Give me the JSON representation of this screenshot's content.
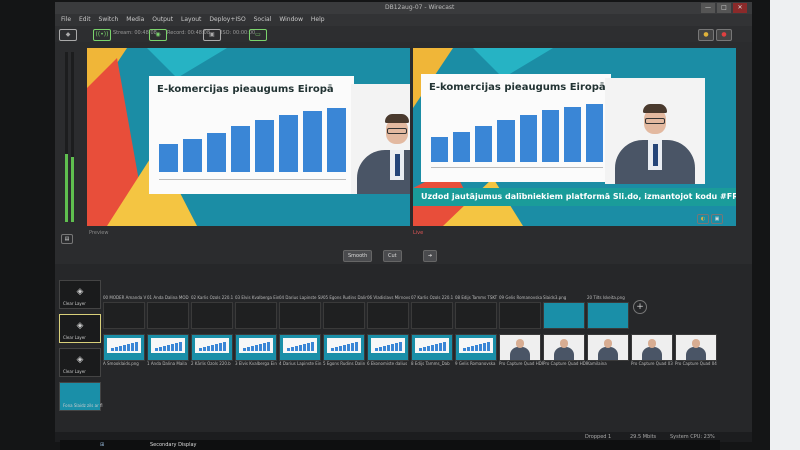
{
  "window": {
    "title": "DB12aug-07 - Wirecast",
    "min": "—",
    "max": "□",
    "close": "✕"
  },
  "menu": [
    "File",
    "Edit",
    "Switch",
    "Media",
    "Output",
    "Layout",
    "Deploy+ISO",
    "Social",
    "Window",
    "Help"
  ],
  "status": {
    "stream_icon": "broadcast-icon",
    "stream_label": "Stream: 00:48:08",
    "record_label": "Record: 00:48:08",
    "iso_label": "ISO: 00:00:00",
    "right_buttons": [
      "●",
      "●"
    ]
  },
  "preview": {
    "slide_title": "E-komercijas pieaugums Eiropā",
    "label": "Preview"
  },
  "live": {
    "slide_title": "E-komercijas pieaugums Eiropā",
    "banner": "Uzdod jautājumus dalībniekiem platformā Sli.do, izmantojot kodu #FR21",
    "label": "Live"
  },
  "transitions": {
    "smooth": "Smooth",
    "cut": "Cut",
    "go": "➔"
  },
  "layers": [
    "Clear Layer",
    "Clear Layer",
    "Clear Layer",
    "Fona Slaidz zils ar fl"
  ],
  "shots_top": [
    "00 MODER Amanda V",
    "01 Anda Dalina MOD",
    "02 Karlis Ozols 220.1",
    "03 Elvis Kvalberga Ein",
    "04 Darius Lapinste SIA",
    "05 Egons Rudins Dalin",
    "06 Vladislavs Mirnovs",
    "07 Karlis Ozols 220.1",
    "08 Edijs Tamms TSKT",
    "09 Gelis Romanovska",
    "Slaids3.png",
    "20 Tilts Iskeita.png"
  ],
  "shots_bottom": [
    "A Smooklaids.png",
    "1 Anda Dalina Maila",
    "2 Kārlis Ozols 220.b",
    "3 Elvis Kvalberga Ein",
    "4 Darius Lapinste Ein",
    "5 Egons Rudins Dalin",
    "6 Ekonomiste dalius",
    "8 Edijs Tamms_Dab",
    "9 Gelis Romanovska",
    "Pro Capture Quad HDF",
    "Pro Capture Quad HDF",
    "Kamilaina",
    "Pro Capture Quad 03",
    "Pro Capture Quad 04"
  ],
  "footer": {
    "dropped": "Dropped 1",
    "bitrate": "29.5 Mbits",
    "cpu": "System CPU: 23%"
  },
  "taskbar": {
    "display": "Secondary Display"
  },
  "chart_values": [
    28,
    34,
    40,
    47,
    53,
    58,
    62,
    65
  ]
}
